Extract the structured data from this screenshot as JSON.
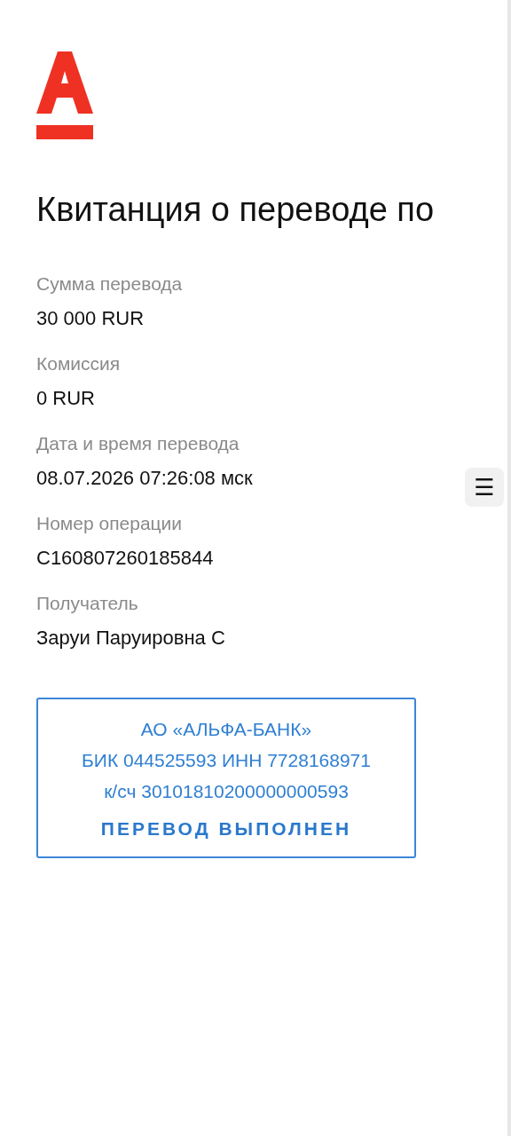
{
  "title": "Квитанция о переводе по",
  "fields": [
    {
      "label": "Сумма перевода",
      "value": "30 000 RUR"
    },
    {
      "label": "Комиссия",
      "value": "0 RUR"
    },
    {
      "label": "Дата и время перевода",
      "value": "08.07.2026 07:26:08 мск"
    },
    {
      "label": "Номер операции",
      "value": "C160807260185844"
    },
    {
      "label": "Получатель",
      "value": "Заруи Паруировна С"
    }
  ],
  "stamp": {
    "lines": [
      "АО «АЛЬФА-БАНК»",
      "БИК 044525593 ИНН 7728168971",
      "к/сч 30101810200000000593"
    ],
    "status": "ПЕРЕВОД ВЫПОЛНЕН"
  },
  "menu_button": {
    "label": "☰"
  }
}
